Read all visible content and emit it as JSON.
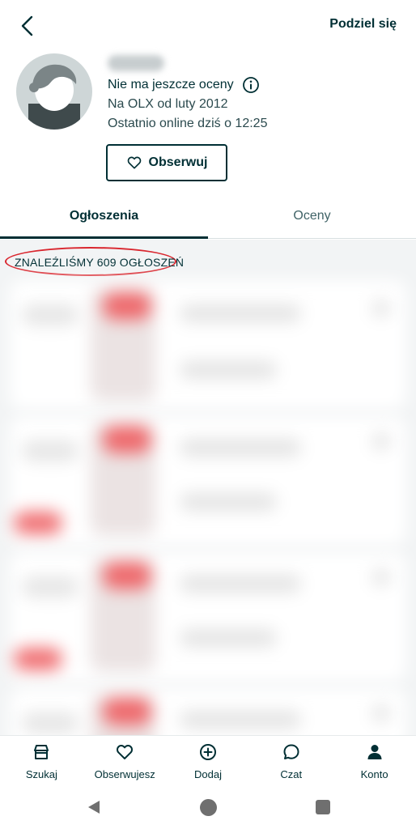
{
  "header": {
    "back_icon": "chevron-left-icon",
    "share_label": "Podziel się"
  },
  "profile": {
    "rating_text": "Nie ma jeszcze oceny",
    "member_since": "Na OLX od luty 2012",
    "last_online": "Ostatnio online dziś o 12:25",
    "follow_label": "Obserwuj"
  },
  "tabs": [
    {
      "label": "Ogłoszenia",
      "active": true
    },
    {
      "label": "Oceny",
      "active": false
    }
  ],
  "results": {
    "count_label": "ZNALEŹLIŚMY 609 OGŁOSZEŃ"
  },
  "bottom_nav": [
    {
      "label": "Szukaj",
      "icon": "home-store-icon"
    },
    {
      "label": "Obserwujesz",
      "icon": "heart-icon"
    },
    {
      "label": "Dodaj",
      "icon": "plus-circle-icon"
    },
    {
      "label": "Czat",
      "icon": "chat-bubble-icon"
    },
    {
      "label": "Konto",
      "icon": "person-icon"
    }
  ],
  "colors": {
    "primary": "#002f34",
    "highlight_circle": "#d9262e",
    "results_bg": "#f2f4f5"
  }
}
